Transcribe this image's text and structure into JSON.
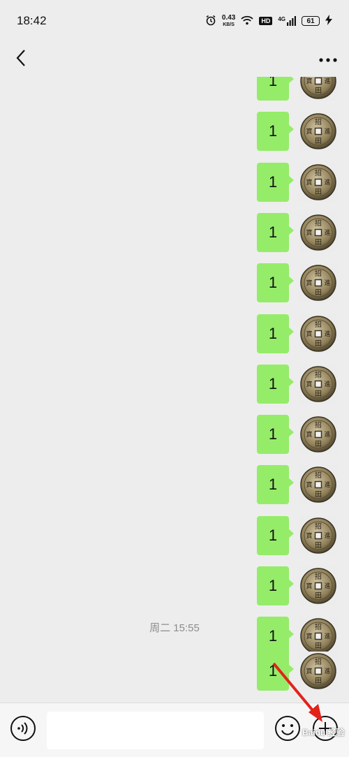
{
  "status_bar": {
    "time": "18:42",
    "net_speed_value": "0.43",
    "net_speed_unit": "KB/S",
    "hd_label": "HD",
    "network_label": "4G",
    "battery": "61",
    "icons": [
      "alarm-icon",
      "wifi-icon",
      "signal-icon",
      "battery-icon",
      "charging-icon"
    ]
  },
  "topbar": {
    "back_icon": "chevron-left-icon",
    "more_icon": "more-dots-icon"
  },
  "messages_before": [
    {
      "text": "1",
      "sender": "self"
    },
    {
      "text": "1",
      "sender": "self"
    },
    {
      "text": "1",
      "sender": "self"
    },
    {
      "text": "1",
      "sender": "self"
    },
    {
      "text": "1",
      "sender": "self"
    },
    {
      "text": "1",
      "sender": "self"
    },
    {
      "text": "1",
      "sender": "self"
    },
    {
      "text": "1",
      "sender": "self"
    },
    {
      "text": "1",
      "sender": "self"
    },
    {
      "text": "1",
      "sender": "self"
    },
    {
      "text": "1",
      "sender": "self"
    },
    {
      "text": "1",
      "sender": "self"
    }
  ],
  "timestamp": "周二 15:55",
  "messages_after": [
    {
      "text": "1",
      "sender": "self"
    }
  ],
  "avatar": {
    "chars": [
      "招",
      "進",
      "寶",
      "田"
    ],
    "icon": "coin-avatar-icon"
  },
  "input_bar": {
    "value": "",
    "placeholder": "",
    "voice_icon": "voice-icon",
    "emoji_icon": "emoji-icon",
    "plus_icon": "plus-circle-icon"
  },
  "annotation": {
    "arrow_color": "#e2231a"
  },
  "watermark": "Baidu 经验",
  "colors": {
    "bubble": "#95ec69",
    "background": "#ededed"
  }
}
